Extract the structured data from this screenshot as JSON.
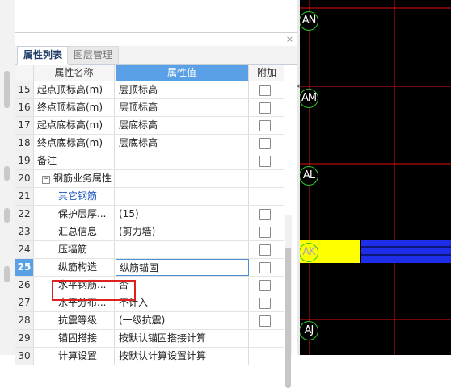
{
  "panel": {
    "close_glyph": "×"
  },
  "tabs": [
    {
      "label": "属性列表",
      "active": true
    },
    {
      "label": "图层管理",
      "active": false
    }
  ],
  "table": {
    "headers": {
      "name": "属性名称",
      "value": "属性值",
      "add": "附加"
    },
    "rows": [
      {
        "num": "15",
        "name": "起点顶标高(m)",
        "value": "层顶标高",
        "checkbox": true
      },
      {
        "num": "16",
        "name": "终点顶标高(m)",
        "value": "层顶标高",
        "checkbox": true
      },
      {
        "num": "17",
        "name": "起点底标高(m)",
        "value": "层底标高",
        "checkbox": true
      },
      {
        "num": "18",
        "name": "终点底标高(m)",
        "value": "层底标高",
        "checkbox": true
      },
      {
        "num": "19",
        "name": "备注",
        "value": "",
        "checkbox": true
      },
      {
        "num": "20",
        "name": "钢筋业务属性",
        "value": "",
        "checkbox": false,
        "toggle": "−"
      },
      {
        "num": "21",
        "name": "其它钢筋",
        "value": "",
        "checkbox": false
      },
      {
        "num": "22",
        "name": "保护层厚...",
        "value": "(15)",
        "checkbox": true
      },
      {
        "num": "23",
        "name": "汇总信息",
        "value": "(剪力墙)",
        "checkbox": true
      },
      {
        "num": "24",
        "name": "压墙筋",
        "value": "",
        "checkbox": true
      },
      {
        "num": "25",
        "name": "纵筋构造",
        "value": "纵筋锚固",
        "checkbox": true,
        "selected": true
      },
      {
        "num": "26",
        "name": "水平钢筋...",
        "value": "否",
        "checkbox": true
      },
      {
        "num": "27",
        "name": "水平分布...",
        "value": "不计入",
        "checkbox": true
      },
      {
        "num": "28",
        "name": "抗震等级",
        "value": "(一级抗震)",
        "checkbox": true
      },
      {
        "num": "29",
        "name": "锚固搭接",
        "value": "按默认锚固搭接计算",
        "checkbox": false
      },
      {
        "num": "30",
        "name": "计算设置",
        "value": "按默认计算设置计算",
        "checkbox": false
      }
    ]
  },
  "cad": {
    "axis_labels": [
      "AN",
      "AM",
      "AL",
      "AK",
      "AJ"
    ],
    "colors": {
      "background": "#000000",
      "grid_red": "#e01010",
      "axis_green": "#2ec72e",
      "beam_yellow": "#ffff00",
      "beam_blue": "#1e2ee8"
    }
  }
}
